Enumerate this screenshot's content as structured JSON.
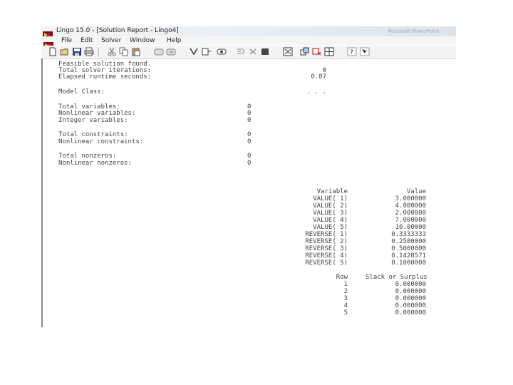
{
  "window": {
    "title": "Lingo 15.0 - [Solution Report - Lingo4]",
    "title_right": "Microsoft PowerPoint"
  },
  "menu": [
    "File",
    "Edit",
    "Solver",
    "Window",
    "Help"
  ],
  "toolbar": [
    {
      "icon": "new-file-icon"
    },
    {
      "icon": "open-folder-icon"
    },
    {
      "icon": "save-icon"
    },
    {
      "icon": "print-icon"
    },
    {
      "icon": "cut-icon"
    },
    {
      "icon": "copy-icon"
    },
    {
      "icon": "paste-icon"
    },
    {
      "icon": "find-icon"
    },
    {
      "icon": "find-next-icon"
    },
    {
      "icon": "goto-line-icon"
    },
    {
      "icon": "match-paren-icon"
    },
    {
      "icon": "solve-icon"
    },
    {
      "icon": "solution-icon"
    },
    {
      "icon": "close-icon"
    },
    {
      "icon": "stop-icon"
    },
    {
      "icon": "options-icon"
    },
    {
      "icon": "send-to-back-icon"
    },
    {
      "icon": "close-all-icon"
    },
    {
      "icon": "tile-icon"
    },
    {
      "icon": "help-icon"
    },
    {
      "icon": "context-help-icon"
    }
  ],
  "report": {
    "status_rows": [
      {
        "label": "Feasible solution found.",
        "value": ""
      },
      {
        "label": "Total solver iterations:",
        "value": "0"
      },
      {
        "label": "Elapsed runtime seconds:",
        "value": "0.07"
      },
      {
        "label": "Model Class:",
        "value": ". . ."
      }
    ],
    "stats_rows": [
      {
        "label": "Total variables:",
        "value": "0"
      },
      {
        "label": "Nonlinear variables:",
        "value": "0"
      },
      {
        "label": "Integer variables:",
        "value": "0"
      },
      {
        "label": "Total constraints:",
        "value": "0"
      },
      {
        "label": "Nonlinear constraints:",
        "value": "0"
      },
      {
        "label": "Total nonzeros:",
        "value": "0"
      },
      {
        "label": "Nonlinear nonzeros:",
        "value": "0"
      }
    ],
    "variables_header": {
      "name": "Variable",
      "value": "Value"
    },
    "variables": [
      {
        "name": "VALUE( 1)",
        "value": "3.000000"
      },
      {
        "name": "VALUE( 2)",
        "value": "4.000000"
      },
      {
        "name": "VALUE( 3)",
        "value": "2.000000"
      },
      {
        "name": "VALUE( 4)",
        "value": "7.000000"
      },
      {
        "name": "VALUE( 5)",
        "value": "10.00000"
      },
      {
        "name": "REVERSE( 1)",
        "value": "0.3333333"
      },
      {
        "name": "REVERSE( 2)",
        "value": "0.2500000"
      },
      {
        "name": "REVERSE( 3)",
        "value": "0.5000000"
      },
      {
        "name": "REVERSE( 4)",
        "value": "0.1428571"
      },
      {
        "name": "REVERSE( 5)",
        "value": "0.1000000"
      }
    ],
    "rows_header": {
      "row": "Row",
      "slack": "Slack or Surplus"
    },
    "rows": [
      {
        "row": "1",
        "slack": "0.000000"
      },
      {
        "row": "2",
        "slack": "0.000000"
      },
      {
        "row": "3",
        "slack": "0.000000"
      },
      {
        "row": "4",
        "slack": "0.000000"
      },
      {
        "row": "5",
        "slack": "0.000000"
      }
    ]
  }
}
